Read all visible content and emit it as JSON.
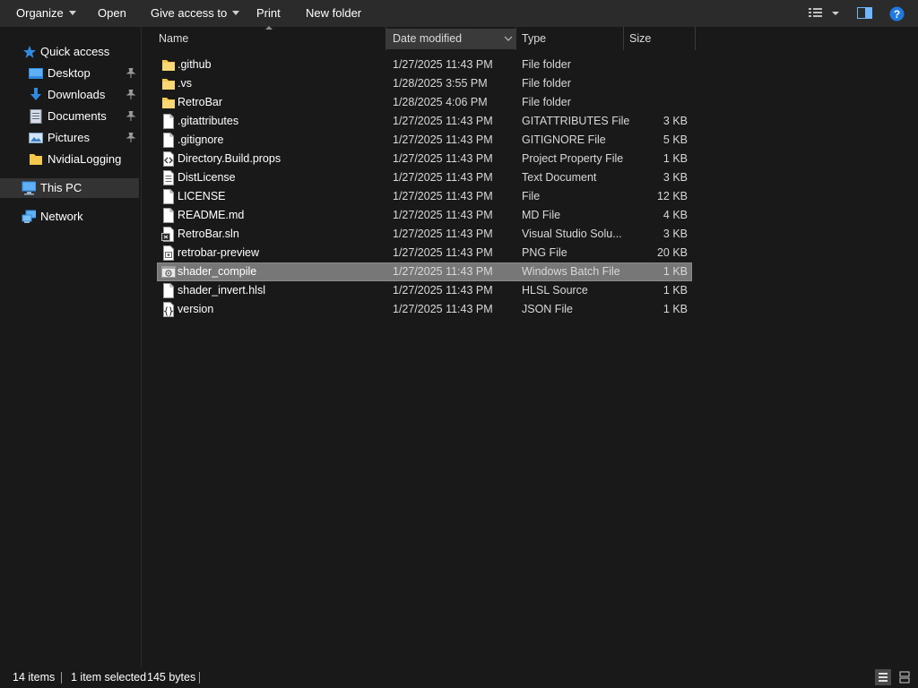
{
  "toolbar": {
    "organize": "Organize",
    "open": "Open",
    "give_access": "Give access to",
    "print": "Print",
    "new_folder": "New folder"
  },
  "nav": {
    "quick_access": "Quick access",
    "items": [
      {
        "label": "Desktop",
        "icon": "desktop-icon"
      },
      {
        "label": "Downloads",
        "icon": "downloads-icon"
      },
      {
        "label": "Documents",
        "icon": "documents-icon"
      },
      {
        "label": "Pictures",
        "icon": "pictures-icon"
      },
      {
        "label": "NvidiaLogging",
        "icon": "folder-icon"
      }
    ],
    "this_pc": "This PC",
    "network": "Network"
  },
  "columns": {
    "name": "Name",
    "date": "Date modified",
    "type": "Type",
    "size": "Size"
  },
  "files": [
    {
      "name": ".github",
      "date": "1/27/2025 11:43 PM",
      "type": "File folder",
      "size": "",
      "icon": "folder-icon"
    },
    {
      "name": ".vs",
      "date": "1/28/2025 3:55 PM",
      "type": "File folder",
      "size": "",
      "icon": "folder-icon"
    },
    {
      "name": "RetroBar",
      "date": "1/28/2025 4:06 PM",
      "type": "File folder",
      "size": "",
      "icon": "folder-icon"
    },
    {
      "name": ".gitattributes",
      "date": "1/27/2025 11:43 PM",
      "type": "GITATTRIBUTES File",
      "size": "3 KB",
      "icon": "file-icon"
    },
    {
      "name": ".gitignore",
      "date": "1/27/2025 11:43 PM",
      "type": "GITIGNORE File",
      "size": "5 KB",
      "icon": "file-icon"
    },
    {
      "name": "Directory.Build.props",
      "date": "1/27/2025 11:43 PM",
      "type": "Project Property File",
      "size": "1 KB",
      "icon": "props-file-icon"
    },
    {
      "name": "DistLicense",
      "date": "1/27/2025 11:43 PM",
      "type": "Text Document",
      "size": "3 KB",
      "icon": "text-file-icon"
    },
    {
      "name": "LICENSE",
      "date": "1/27/2025 11:43 PM",
      "type": "File",
      "size": "12 KB",
      "icon": "file-icon"
    },
    {
      "name": "README.md",
      "date": "1/27/2025 11:43 PM",
      "type": "MD File",
      "size": "4 KB",
      "icon": "file-icon"
    },
    {
      "name": "RetroBar.sln",
      "date": "1/27/2025 11:43 PM",
      "type": "Visual Studio Solu...",
      "size": "3 KB",
      "icon": "solution-file-icon"
    },
    {
      "name": "retrobar-preview",
      "date": "1/27/2025 11:43 PM",
      "type": "PNG File",
      "size": "20 KB",
      "icon": "image-file-icon"
    },
    {
      "name": "shader_compile",
      "date": "1/27/2025 11:43 PM",
      "type": "Windows Batch File",
      "size": "1 KB",
      "icon": "batch-file-icon",
      "selected": true
    },
    {
      "name": "shader_invert.hlsl",
      "date": "1/27/2025 11:43 PM",
      "type": "HLSL Source",
      "size": "1 KB",
      "icon": "file-icon"
    },
    {
      "name": "version",
      "date": "1/27/2025 11:43 PM",
      "type": "JSON File",
      "size": "1 KB",
      "icon": "json-file-icon"
    }
  ],
  "status": {
    "items": "14 items",
    "selected": "1 item selected",
    "bytes": "145 bytes"
  },
  "colors": {
    "background": "#191919",
    "toolbar": "#2b2b2b",
    "selection": "#777777",
    "folder": "#f5c84c",
    "accent_blue": "#2f8ae0"
  }
}
